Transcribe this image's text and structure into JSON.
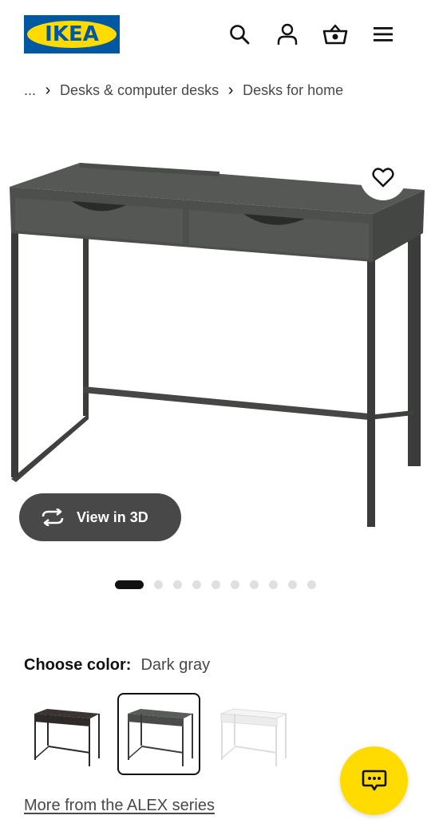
{
  "header": {
    "logo_text": "IKEA",
    "colors": {
      "logo_blue": "#0058a3",
      "logo_yellow": "#ffdb00"
    },
    "icons": [
      "search-icon",
      "account-icon",
      "cart-icon",
      "menu-icon"
    ]
  },
  "breadcrumb": {
    "ellipsis": "...",
    "items": [
      "Desks & computer desks",
      "Desks for home"
    ]
  },
  "gallery": {
    "view3d_label": "View in 3D",
    "image_count": 10,
    "active_index": 0
  },
  "color": {
    "label": "Choose color:",
    "value": "Dark gray",
    "swatches": [
      {
        "name": "black-brown",
        "selected": false
      },
      {
        "name": "dark gray",
        "selected": true
      },
      {
        "name": "white",
        "selected": false
      }
    ]
  },
  "series_link": "More from the ALEX series",
  "chat": {
    "icon": "chat-icon",
    "color": "#ffdb00"
  }
}
